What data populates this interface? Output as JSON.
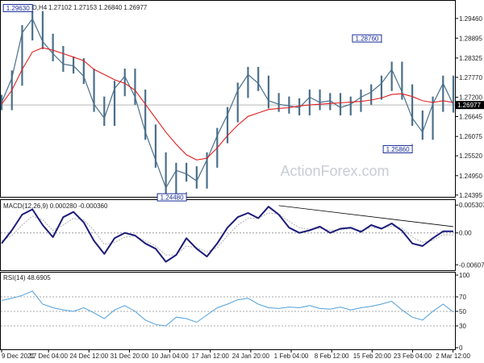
{
  "header": {
    "symbol": "USDCAD,H4",
    "ohlc": "1.27102 1.27153 1.26840 1.26977"
  },
  "watermark": "ActionForex.com",
  "colors": {
    "price": "#4a6f8a",
    "ema": "#e02020",
    "macd": "#1c1c7a",
    "signal": "#b0b0b0",
    "rsi": "#4f9fdc",
    "trendline": "#000000",
    "grid": "#d0d0d0"
  },
  "chart_data": [
    {
      "type": "line",
      "title": "USDCAD,H4",
      "ylim": [
        1.2439,
        1.2985
      ],
      "y_ticks": [
        "1.29460",
        "1.28895",
        "1.28325",
        "1.27770",
        "1.27200",
        "1.26645",
        "1.26075",
        "1.25520",
        "1.24950",
        "1.24395"
      ],
      "current_price_label": "1.26977",
      "current_price": 1.26977,
      "x_ticks": [
        "9 Dec 2021",
        "17 Dec 04:00",
        "24 Dec 12:00",
        "31 Dec 20:00",
        "10 Jan 04:00",
        "17 Jan 12:00",
        "24 Jan 20:00",
        "1 Feb 04:00",
        "8 Feb 12:00",
        "15 Feb 20:00",
        "23 Feb 04:00",
        "2 Mar 12:00"
      ],
      "series": [
        {
          "style": "close",
          "values": [
            1.2705,
            1.2775,
            1.2905,
            1.2945,
            1.288,
            1.2845,
            1.2815,
            1.281,
            1.278,
            1.27,
            1.266,
            1.2745,
            1.278,
            1.272,
            1.262,
            1.254,
            1.246,
            1.251,
            1.25,
            1.248,
            1.254,
            1.261,
            1.267,
            1.274,
            1.2785,
            1.276,
            1.271,
            1.27,
            1.2695,
            1.269,
            1.272,
            1.2705,
            1.271,
            1.269,
            1.27,
            1.272,
            1.2735,
            1.276,
            1.28,
            1.2735,
            1.266,
            1.262,
            1.27,
            1.276,
            1.2698
          ]
        },
        {
          "style": "ema",
          "values": [
            1.27,
            1.274,
            1.28,
            1.285,
            1.2862,
            1.2855,
            1.2845,
            1.2835,
            1.2825,
            1.28,
            1.2785,
            1.277,
            1.276,
            1.274,
            1.27,
            1.266,
            1.262,
            1.2585,
            1.2555,
            1.254,
            1.2545,
            1.2575,
            1.261,
            1.264,
            1.2665,
            1.2675,
            1.2685,
            1.2688,
            1.269,
            1.2695,
            1.2698,
            1.27,
            1.2702,
            1.2704,
            1.2706,
            1.2708,
            1.2712,
            1.2718,
            1.2728,
            1.273,
            1.2722,
            1.271,
            1.2705,
            1.271,
            1.2705
          ]
        }
      ],
      "annotations": [
        {
          "label": "1.29630",
          "x_index": 3,
          "value": 1.2963
        },
        {
          "label": "1.24480",
          "x_index": 18,
          "value": 1.2448
        },
        {
          "label": "1.28760",
          "x_index": 37,
          "value": 1.2876
        },
        {
          "label": "1.25860",
          "x_index": 40,
          "value": 1.2586
        }
      ]
    },
    {
      "type": "line",
      "title": "MACD(12,26,9) 0.000280 -0.000360",
      "ylim": [
        -0.0068,
        0.0058
      ],
      "y_ticks": [
        "0.005307",
        "0.00",
        "-0.006074"
      ],
      "series": [
        {
          "style": "macd",
          "values": [
            -0.002,
            0.0005,
            0.0035,
            0.0045,
            0.0015,
            -0.0008,
            0.003,
            0.004,
            0.002,
            -0.0015,
            -0.004,
            -0.001,
            0.0,
            -0.0005,
            -0.002,
            -0.003,
            -0.0055,
            -0.0042,
            -0.001,
            -0.003,
            -0.0045,
            -0.002,
            0.001,
            0.003,
            0.0038,
            0.0028,
            0.005,
            0.0035,
            0.001,
            0.0,
            0.0005,
            0.0012,
            0.0,
            0.0008,
            0.001,
            0.0002,
            0.0015,
            0.0008,
            0.0018,
            0.0004,
            -0.002,
            -0.0025,
            -0.001,
            0.0003,
            0.0003
          ]
        },
        {
          "style": "signal",
          "values": [
            -0.0015,
            -0.0005,
            0.0015,
            0.0032,
            0.0025,
            0.0005,
            0.0015,
            0.0028,
            0.0025,
            0.0005,
            -0.0022,
            -0.0018,
            -0.0008,
            -0.0006,
            -0.0015,
            -0.0025,
            -0.0042,
            -0.0042,
            -0.0025,
            -0.0028,
            -0.0036,
            -0.0028,
            -0.0005,
            0.0015,
            0.0028,
            0.0028,
            0.0038,
            0.0036,
            0.0022,
            0.001,
            0.0007,
            0.0009,
            0.0005,
            0.0006,
            0.0008,
            0.0005,
            0.001,
            0.0009,
            0.0013,
            0.0009,
            -0.0008,
            -0.0018,
            -0.0014,
            -0.0004,
            -0.0004
          ]
        }
      ],
      "trendline": {
        "from": {
          "x_index": 27,
          "value": 0.0052
        },
        "to": {
          "x_index": 44,
          "value": 0.0012
        }
      }
    },
    {
      "type": "line",
      "title": "RSI(14) 48.6905",
      "ylim": [
        0,
        100
      ],
      "y_ticks": [
        "100",
        "70",
        "50",
        "30",
        "0"
      ],
      "series": [
        {
          "style": "rsi",
          "values": [
            65,
            68,
            72,
            78,
            60,
            55,
            52,
            50,
            55,
            48,
            40,
            52,
            58,
            50,
            38,
            32,
            30,
            42,
            40,
            35,
            45,
            55,
            60,
            66,
            68,
            60,
            55,
            54,
            56,
            55,
            58,
            54,
            53,
            56,
            52,
            55,
            57,
            60,
            64,
            52,
            42,
            38,
            50,
            60,
            49
          ]
        }
      ]
    }
  ]
}
